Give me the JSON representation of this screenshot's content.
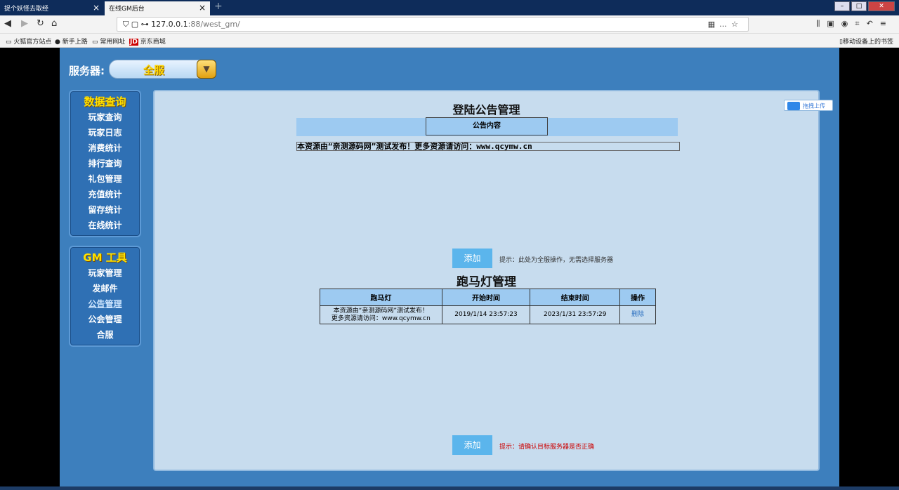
{
  "browser": {
    "tabs": [
      {
        "label": "捉个妖怪去取经"
      },
      {
        "label": "在线GM后台"
      }
    ],
    "url_host": "127.0.0.1",
    "url_rest": ":88/west_gm/",
    "bookmarks": [
      "火狐官方站点",
      "新手上路",
      "常用网址",
      "京东商城"
    ],
    "bookmarks_right": "移动设备上的书签"
  },
  "server": {
    "label": "服务器:",
    "selected": "全服"
  },
  "menu_data": {
    "title": "数据查询",
    "items": [
      "玩家查询",
      "玩家日志",
      "消费统计",
      "排行查询",
      "礼包管理",
      "充值统计",
      "留存统计",
      "在线统计"
    ]
  },
  "menu_gm": {
    "title": "GM 工具",
    "items": [
      "玩家管理",
      "发邮件",
      "公告管理",
      "公会管理",
      "合服"
    ]
  },
  "login_notice": {
    "title": "登陆公告管理",
    "column": "公告内容",
    "text": "本资源由“亲测源码网”测试发布！更多资源请访问：www.qcymw.cn",
    "add_label": "添加",
    "hint": "提示：此处为全服操作，无需选择服务器"
  },
  "marquee": {
    "title": "跑马灯管理",
    "columns": [
      "跑马灯",
      "开始时间",
      "结束时间",
      "操作"
    ],
    "rows": [
      {
        "text_line1": "本资源由“亲测源码网”测试发布！",
        "text_line2": "更多资源请访问：www.qcymw.cn",
        "start": "2019/1/14 23:57:23",
        "end": "2023/1/31 23:57:29",
        "action": "删除"
      }
    ],
    "add_label": "添加",
    "hint": "提示：请确认目标服务器是否正确"
  },
  "baidu_widget": {
    "label": "拖拽上传"
  },
  "colors": {
    "page_bg": "#3d7fbd",
    "content_bg": "#c7dcee",
    "header_bg": "#9dcaf1",
    "button_bg": "#5bb5ec",
    "menu_title": "#ffe100",
    "hint_red": "#cc0000"
  }
}
